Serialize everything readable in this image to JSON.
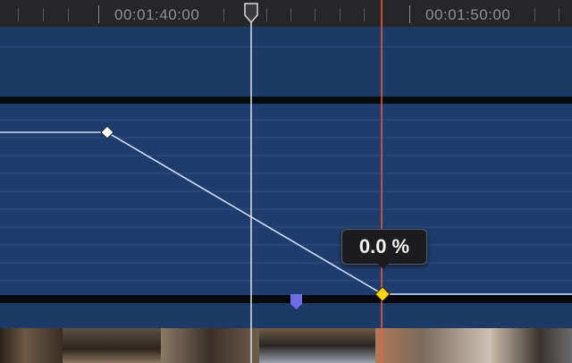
{
  "ruler": {
    "timecodes": [
      "00:01:40:00",
      "00:01:50:00"
    ]
  },
  "keyframe_editor": {
    "value_tooltip": "0.0 %",
    "keyframes": [
      {
        "id": "keyframe-1",
        "selected": false
      },
      {
        "id": "keyframe-2",
        "selected": true
      }
    ],
    "curve_color": "#cfe0ff"
  },
  "colors": {
    "playhead": "#e0e0e4",
    "skimmer": "#ff5a36",
    "selected_keyframe": "#ffd60a",
    "marker": "#6e6ee6",
    "lane": "#1f3d6c"
  },
  "filmstrip": {
    "description_frames": 6
  }
}
